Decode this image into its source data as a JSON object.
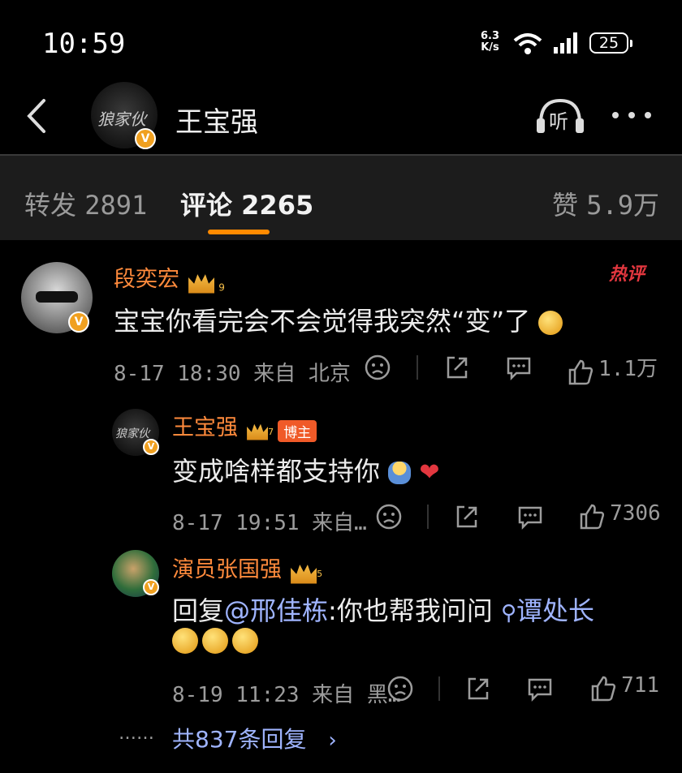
{
  "status_bar": {
    "time": "10:59",
    "net_speed_value": "6.3",
    "net_speed_unit": "K/s",
    "battery": "25"
  },
  "header": {
    "title": "王宝强",
    "listen_label": "听",
    "avatar_logo_text": "狼家伙",
    "more_icon": "more-dots-icon"
  },
  "tabs": [
    {
      "label": "转发",
      "count": "2891"
    },
    {
      "label": "评论",
      "count": "2265"
    },
    {
      "label": "赞",
      "count": "5.9万"
    }
  ],
  "comments": [
    {
      "name": "段奕宏",
      "level": "9",
      "hot_label": "热评",
      "text": "宝宝你看完会不会觉得我突然“变”了",
      "meta": "8-17 18:30 来自 北京",
      "likes": "1.1万"
    },
    {
      "name": "王宝强",
      "level": "7",
      "role": "博主",
      "text": "变成啥样都支持你",
      "meta": "8-17 19:51 来自…",
      "likes": "7306"
    },
    {
      "name": "演员张国强",
      "level": "5",
      "text_prefix": "回复",
      "mention": "@邢佳栋",
      "text_mid": ":你也帮我问问",
      "topic": "谭处长",
      "meta": "8-19 11:23 来自 黑…",
      "likes": "711"
    }
  ],
  "more_replies": {
    "dots": "……",
    "label": "共837条回复"
  },
  "colors": {
    "accent": "#ff8a00",
    "name": "#ff8a3c",
    "link": "#9fb4ff",
    "hot": "#e3373f"
  }
}
